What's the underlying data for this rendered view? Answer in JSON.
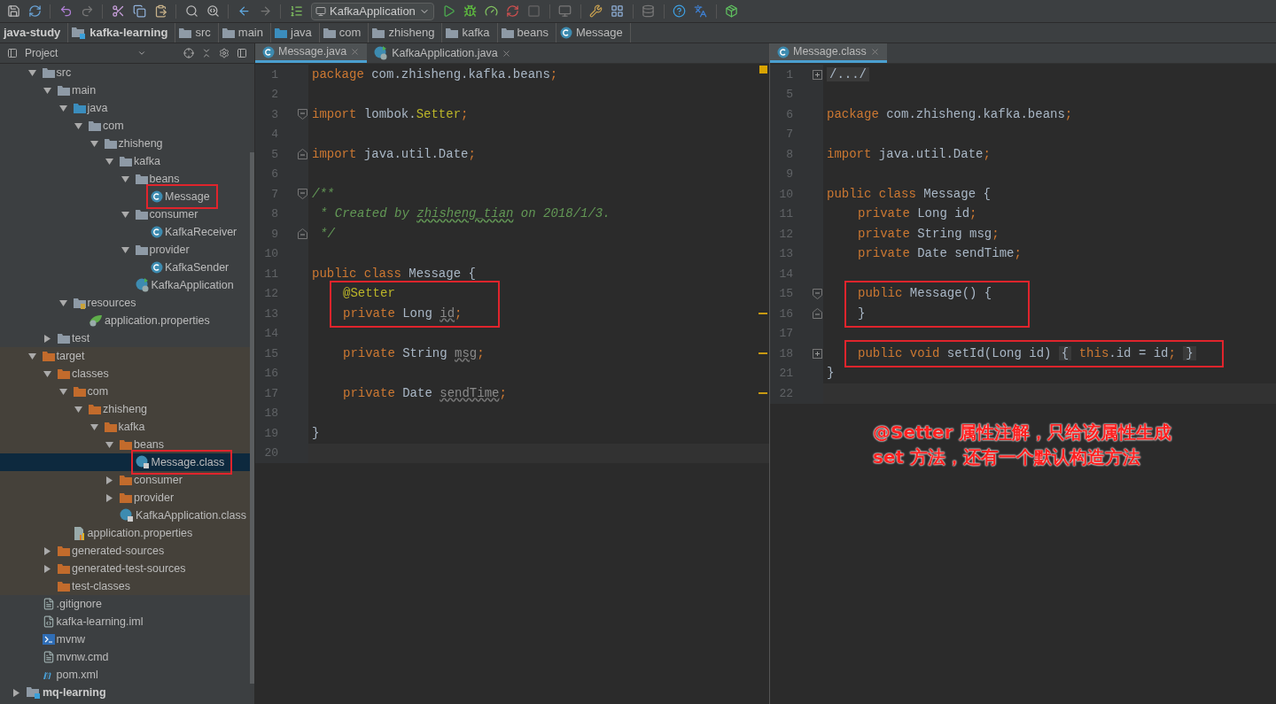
{
  "toolbar": {
    "run_config": "KafkaApplication"
  },
  "breadcrumbs": [
    {
      "label": "java-study",
      "kind": "project"
    },
    {
      "label": "kafka-learning",
      "kind": "module"
    },
    {
      "label": "src",
      "kind": "folder"
    },
    {
      "label": "main",
      "kind": "folder"
    },
    {
      "label": "java",
      "kind": "source"
    },
    {
      "label": "com",
      "kind": "package"
    },
    {
      "label": "zhisheng",
      "kind": "package"
    },
    {
      "label": "kafka",
      "kind": "package"
    },
    {
      "label": "beans",
      "kind": "package"
    },
    {
      "label": "Message",
      "kind": "class"
    }
  ],
  "project_panel": {
    "title": "Project",
    "items": [
      {
        "name": "src",
        "kind": "folder",
        "expanded": true,
        "children": [
          {
            "name": "main",
            "kind": "folder",
            "expanded": true,
            "children": [
              {
                "name": "java",
                "kind": "source",
                "expanded": true,
                "children": [
                  {
                    "name": "com",
                    "kind": "package",
                    "expanded": true,
                    "children": [
                      {
                        "name": "zhisheng",
                        "kind": "package",
                        "expanded": true,
                        "children": [
                          {
                            "name": "kafka",
                            "kind": "package",
                            "expanded": true,
                            "children": [
                              {
                                "name": "beans",
                                "kind": "package",
                                "expanded": true,
                                "children": [
                                  {
                                    "name": "Message",
                                    "kind": "class",
                                    "boxed": true,
                                    "selected": false
                                  }
                                ]
                              },
                              {
                                "name": "consumer",
                                "kind": "package",
                                "expanded": true,
                                "children": [
                                  {
                                    "name": "KafkaReceiver",
                                    "kind": "class",
                                    "selected": false
                                  }
                                ]
                              },
                              {
                                "name": "provider",
                                "kind": "package",
                                "expanded": true,
                                "children": [
                                  {
                                    "name": "KafkaSender",
                                    "kind": "class",
                                    "selected": false
                                  }
                                ]
                              },
                              {
                                "name": "KafkaApplication",
                                "kind": "app",
                                "selected": false
                              }
                            ]
                          }
                        ]
                      }
                    ]
                  }
                ]
              },
              {
                "name": "resources",
                "kind": "resources",
                "expanded": true,
                "children": [
                  {
                    "name": "application.properties",
                    "kind": "spring",
                    "selected": false
                  }
                ]
              }
            ]
          },
          {
            "name": "test",
            "kind": "folder",
            "expanded": false
          }
        ]
      },
      {
        "name": "target",
        "kind": "excluded",
        "excluded": true,
        "expanded": true,
        "children": [
          {
            "name": "classes",
            "kind": "excluded",
            "expanded": true,
            "children": [
              {
                "name": "com",
                "kind": "excluded",
                "expanded": true,
                "children": [
                  {
                    "name": "zhisheng",
                    "kind": "excluded",
                    "expanded": true,
                    "children": [
                      {
                        "name": "kafka",
                        "kind": "excluded",
                        "expanded": true,
                        "children": [
                          {
                            "name": "beans",
                            "kind": "excluded",
                            "expanded": true,
                            "children": [
                              {
                                "name": "Message.class",
                                "kind": "compiled",
                                "boxed": true,
                                "selected": true
                              }
                            ]
                          },
                          {
                            "name": "consumer",
                            "kind": "excluded",
                            "expanded": false
                          },
                          {
                            "name": "provider",
                            "kind": "excluded",
                            "expanded": false
                          },
                          {
                            "name": "KafkaApplication.class",
                            "kind": "compiled",
                            "selected": false
                          }
                        ]
                      }
                    ]
                  }
                ]
              },
              {
                "name": "application.properties",
                "kind": "props",
                "selected": false
              }
            ]
          },
          {
            "name": "generated-sources",
            "kind": "excluded",
            "expanded": false
          },
          {
            "name": "generated-test-sources",
            "kind": "excluded",
            "expanded": false
          },
          {
            "name": "test-classes",
            "kind": "excluded",
            "selected": false
          }
        ]
      },
      {
        "name": ".gitignore",
        "kind": "file",
        "selected": false
      },
      {
        "name": "kafka-learning.iml",
        "kind": "iml",
        "selected": false
      },
      {
        "name": "mvnw",
        "kind": "shell",
        "selected": false
      },
      {
        "name": "mvnw.cmd",
        "kind": "file",
        "selected": false
      },
      {
        "name": "pom.xml",
        "kind": "maven",
        "selected": false
      }
    ],
    "root_items": [
      {
        "name": "mq-learning",
        "kind": "module",
        "expanded": false
      }
    ]
  },
  "editors": [
    {
      "tabs": [
        {
          "label": "Message.java",
          "kind": "class",
          "selected": true
        },
        {
          "label": "KafkaApplication.java",
          "kind": "app",
          "selected": false
        }
      ],
      "lines": [
        {
          "number": "1",
          "tokens": [
            {
              "text": "package",
              "kind": "keyword",
              "gap": true
            },
            {
              "text": "com.zhisheng.kafka.beans",
              "kind": "plain"
            },
            {
              "text": ";",
              "kind": "keyword"
            }
          ]
        },
        {
          "number": "2"
        },
        {
          "number": "3",
          "fold_start": true,
          "tokens": [
            {
              "text": "import",
              "kind": "keyword",
              "gap": true
            },
            {
              "text": "lombok.",
              "kind": "plain"
            },
            {
              "text": "Setter",
              "kind": "annotation"
            },
            {
              "text": ";",
              "kind": "keyword"
            }
          ]
        },
        {
          "number": "4"
        },
        {
          "number": "5",
          "fold_end": true,
          "tokens": [
            {
              "text": "import",
              "kind": "keyword",
              "gap": true
            },
            {
              "text": "java.util.Date",
              "kind": "plain"
            },
            {
              "text": ";",
              "kind": "keyword"
            }
          ]
        },
        {
          "number": "6"
        },
        {
          "number": "7",
          "fold_start": true,
          "tokens": [
            {
              "text": "/**",
              "kind": "comment"
            }
          ]
        },
        {
          "number": "8",
          "continuation": true,
          "tokens": [
            {
              "text": "* Created by",
              "kind": "comment",
              "gap": true
            },
            {
              "text": "zhisheng_tian",
              "kind": "comment-typo",
              "gap": true
            },
            {
              "text": "on 2018/1/3.",
              "kind": "comment"
            }
          ]
        },
        {
          "number": "9",
          "continuation": true,
          "fold_end": true,
          "tokens": [
            {
              "text": "*/",
              "kind": "comment"
            }
          ]
        },
        {
          "number": "10"
        },
        {
          "number": "11",
          "tokens": [
            {
              "text": "public class",
              "kind": "keyword",
              "gap": true
            },
            {
              "text": "Message {",
              "kind": "plain"
            }
          ]
        },
        {
          "number": "12",
          "indented": true,
          "boxed": true,
          "tokens": [
            {
              "text": "@Setter",
              "kind": "annotation"
            }
          ]
        },
        {
          "number": "13",
          "indented": true,
          "boxed": true,
          "warning": true,
          "tokens": [
            {
              "text": "private",
              "kind": "keyword",
              "gap": true
            },
            {
              "text": "Long",
              "kind": "plain",
              "gap": true
            },
            {
              "text": "id",
              "kind": "unused"
            },
            {
              "text": ";",
              "kind": "keyword"
            }
          ]
        },
        {
          "number": "14"
        },
        {
          "number": "15",
          "indented": true,
          "warning": true,
          "tokens": [
            {
              "text": "private",
              "kind": "keyword",
              "gap": true
            },
            {
              "text": "String",
              "kind": "plain",
              "gap": true
            },
            {
              "text": "msg",
              "kind": "unused"
            },
            {
              "text": ";",
              "kind": "keyword"
            }
          ]
        },
        {
          "number": "16"
        },
        {
          "number": "17",
          "indented": true,
          "warning": true,
          "tokens": [
            {
              "text": "private",
              "kind": "keyword",
              "gap": true
            },
            {
              "text": "Date",
              "kind": "plain",
              "gap": true
            },
            {
              "text": "sendTime",
              "kind": "unused"
            },
            {
              "text": ";",
              "kind": "keyword"
            }
          ]
        },
        {
          "number": "18"
        },
        {
          "number": "19",
          "tokens": [
            {
              "text": "}",
              "kind": "plain"
            }
          ]
        },
        {
          "number": "20",
          "current": true
        }
      ]
    },
    {
      "tabs": [
        {
          "label": "Message.class",
          "kind": "class",
          "selected": true
        }
      ],
      "lines": [
        {
          "number": "1",
          "collapsed": true,
          "tokens": [
            {
              "text": "/.../",
              "kind": "folded"
            }
          ]
        },
        {
          "number": "5"
        },
        {
          "number": "6",
          "tokens": [
            {
              "text": "package",
              "kind": "keyword",
              "gap": true
            },
            {
              "text": "com.zhisheng.kafka.beans",
              "kind": "plain"
            },
            {
              "text": ";",
              "kind": "keyword"
            }
          ]
        },
        {
          "number": "7"
        },
        {
          "number": "8",
          "tokens": [
            {
              "text": "import",
              "kind": "keyword",
              "gap": true
            },
            {
              "text": "java.util.Date",
              "kind": "plain"
            },
            {
              "text": ";",
              "kind": "keyword"
            }
          ]
        },
        {
          "number": "9"
        },
        {
          "number": "10",
          "tokens": [
            {
              "text": "public class",
              "kind": "keyword",
              "gap": true
            },
            {
              "text": "Message {",
              "kind": "plain"
            }
          ]
        },
        {
          "number": "11",
          "indented": true,
          "tokens": [
            {
              "text": "private",
              "kind": "keyword",
              "gap": true
            },
            {
              "text": "Long id",
              "kind": "plain"
            },
            {
              "text": ";",
              "kind": "keyword"
            }
          ]
        },
        {
          "number": "12",
          "indented": true,
          "tokens": [
            {
              "text": "private",
              "kind": "keyword",
              "gap": true
            },
            {
              "text": "String msg",
              "kind": "plain"
            },
            {
              "text": ";",
              "kind": "keyword"
            }
          ]
        },
        {
          "number": "13",
          "indented": true,
          "tokens": [
            {
              "text": "private",
              "kind": "keyword",
              "gap": true
            },
            {
              "text": "Date sendTime",
              "kind": "plain"
            },
            {
              "text": ";",
              "kind": "keyword"
            }
          ]
        },
        {
          "number": "14"
        },
        {
          "number": "15",
          "indented": true,
          "boxed": true,
          "fold_start": true,
          "tokens": [
            {
              "text": "public",
              "kind": "keyword",
              "gap": true
            },
            {
              "text": "Message() {",
              "kind": "plain"
            }
          ]
        },
        {
          "number": "16",
          "indented": true,
          "boxed": true,
          "fold_end": true,
          "tokens": [
            {
              "text": "}",
              "kind": "plain"
            }
          ]
        },
        {
          "number": "17"
        },
        {
          "number": "18",
          "indented": true,
          "boxed": true,
          "collapsed": true,
          "tokens": [
            {
              "text": "public void",
              "kind": "keyword",
              "gap": true
            },
            {
              "text": "setId(Long id)",
              "kind": "plain",
              "gap": true
            },
            {
              "text": "{",
              "kind": "folded",
              "gap": true
            },
            {
              "text": "this",
              "kind": "keyword"
            },
            {
              "text": ".id = id",
              "kind": "plain"
            },
            {
              "text": ";",
              "kind": "keyword",
              "gap": true
            },
            {
              "text": "}",
              "kind": "folded"
            }
          ]
        },
        {
          "number": "21",
          "tokens": [
            {
              "text": "}",
              "kind": "plain"
            }
          ]
        },
        {
          "number": "22",
          "current": true
        }
      ],
      "note": [
        "@Setter 属性注解，只给该属性生成",
        "set 方法，还有一个默认构造方法"
      ]
    }
  ]
}
